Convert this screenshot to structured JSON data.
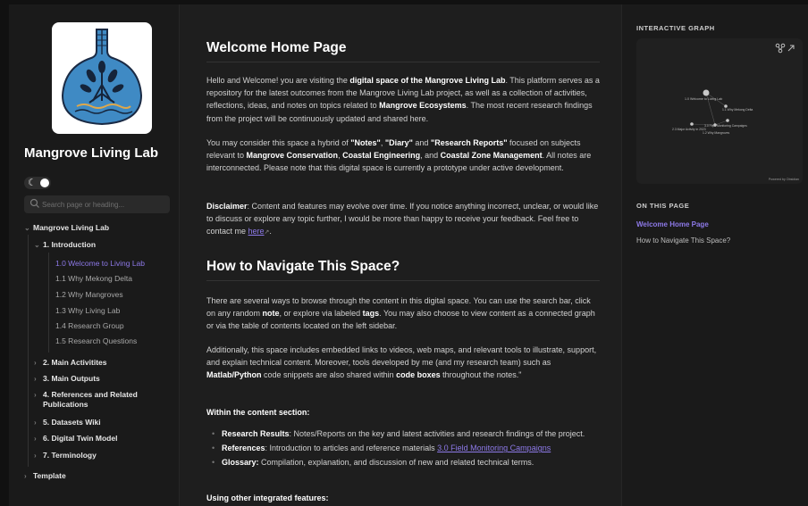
{
  "site": {
    "title": "Mangrove Living Lab",
    "logo": "vase-with-mangrove-tree-logo"
  },
  "search": {
    "placeholder": "Search page or heading..."
  },
  "toggle": {
    "icon": "moon-icon"
  },
  "nav": {
    "root": "Mangrove Living Lab",
    "intro": "1. Introduction",
    "intro_items": [
      "1.0 Welcome to Living Lab",
      "1.1 Why Mekong Delta",
      "1.2 Why Mangroves",
      "1.3 Why Living Lab",
      "1.4 Research Group",
      "1.5 Research Questions"
    ],
    "sections": [
      "2. Main Activitites",
      "3. Main Outputs",
      "4. References and Related Publications",
      "5. Datasets Wiki",
      "6. Digital Twin Model",
      "7. Terminology"
    ],
    "template": "Template"
  },
  "main": {
    "h1": "Welcome Home Page",
    "p1": {
      "a": "Hello and Welcome! you are visiting the ",
      "b": "digital space of the Mangrove Living Lab",
      "c": ". This platform serves as a repository for the latest outcomes from the Mangrove Living Lab project, as well as a collection of activities, reflections, ideas, and notes on topics related to ",
      "d": "Mangrove Ecosystems",
      "e": ". The most recent research findings from the project will be continuously updated and shared here."
    },
    "p2": {
      "a": "You may consider this space a hybrid of ",
      "notes": "\"Notes\"",
      "s1": ", ",
      "diary": "\"Diary\"",
      "s2": " and ",
      "reports": "\"Research Reports\"",
      "s3": " focused on subjects relevant to ",
      "conservation": "Mangrove Conservation",
      "s4": ", ",
      "coastal": "Coastal Engineering",
      "s5": ", and ",
      "czm": "Coastal Zone Management",
      "s6": ". All notes are interconnected. Please note that this digital space is currently a prototype under active development."
    },
    "p3": {
      "label": "Disclaimer",
      "text": ": Content and features may evolve over time. If you notice anything incorrect, unclear, or would like to discuss or explore any topic further, I would be more than happy to receive your feedback. Feel free to contact me ",
      "link": "here",
      "end": "."
    },
    "h2": "How to Navigate This Space?",
    "p4": {
      "a": "There are several ways to browse through the content in this digital space. You can use the search bar, click on any random ",
      "note": "note",
      "b": ", or explore via labeled ",
      "tags": "tags",
      "c": ". You may also choose to view content as a connected graph or via the table of contents located on the left sidebar."
    },
    "p5": {
      "a": "Additionally, this space includes embedded links to videos, web maps, and relevant tools to illustrate, support, and explain technical content. Moreover, tools developed by me (and my research team) such as ",
      "code": "Matlab/Python",
      "b": " code snippets are also shared within ",
      "boxes": "code boxes",
      "c": " throughout the notes.\""
    },
    "within": "Within the content section:",
    "bullets": {
      "b1_label": "Research Results",
      "b1_text": ": Notes/Reports on the key and latest activities and research findings of the project.",
      "b2_label": "References",
      "b2_text": ": Introduction to articles and reference materials ",
      "b2_link": "3.0 Field Monitoring Campaigns",
      "b3_label": "Glossary:",
      "b3_text": " Compilation, explanation, and discussion of new and related technical terms."
    },
    "using": "Using other integrated features:"
  },
  "graph": {
    "heading": "INTERACTIVE GRAPH",
    "nodes": [
      "1.0 Welcome to Living Lab",
      "1.1 Why Mekong Delta",
      "3.0 Field Monitoring Campaigns",
      "2.3 Major Activity in 2023",
      "1.2 Why Mangroves"
    ],
    "credit": "Powered by Obsidian",
    "icons": [
      "graph-view-icon",
      "expand-icon"
    ]
  },
  "toc": {
    "heading": "ON THIS PAGE",
    "items": [
      "Welcome Home Page",
      "How to Navigate This Space?"
    ]
  },
  "colors": {
    "accent": "#8d79e8",
    "background": "#1e1e1e",
    "sidebar": "#1a1a1a"
  }
}
